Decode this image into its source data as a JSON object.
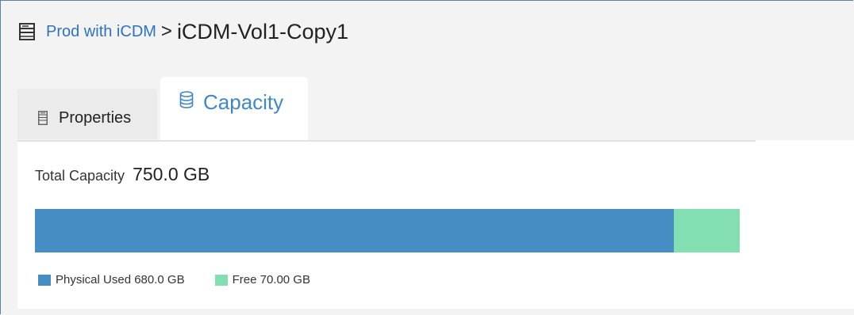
{
  "breadcrumb": {
    "parent": "Prod with iCDM",
    "separator": ">",
    "current": "iCDM-Vol1-Copy1"
  },
  "icons": {
    "header": "server-icon",
    "properties_tab": "list-document-icon",
    "capacity_tab": "database-icon"
  },
  "tabs": [
    {
      "label": "Properties",
      "active": false
    },
    {
      "label": "Capacity",
      "active": true
    }
  ],
  "capacity": {
    "total_label": "Total Capacity",
    "total_value": "750.0 GB",
    "used_fraction": 0.9067,
    "free_fraction": 0.0933,
    "legend": [
      {
        "label": "Physical Used 680.0 GB",
        "color": "#468dc4"
      },
      {
        "label": "Free 70.00 GB",
        "color": "#83deb1"
      }
    ]
  },
  "colors": {
    "link": "#2e73c2",
    "active_tab_text": "#3f87c7",
    "used": "#468dc4",
    "free": "#83deb1"
  }
}
